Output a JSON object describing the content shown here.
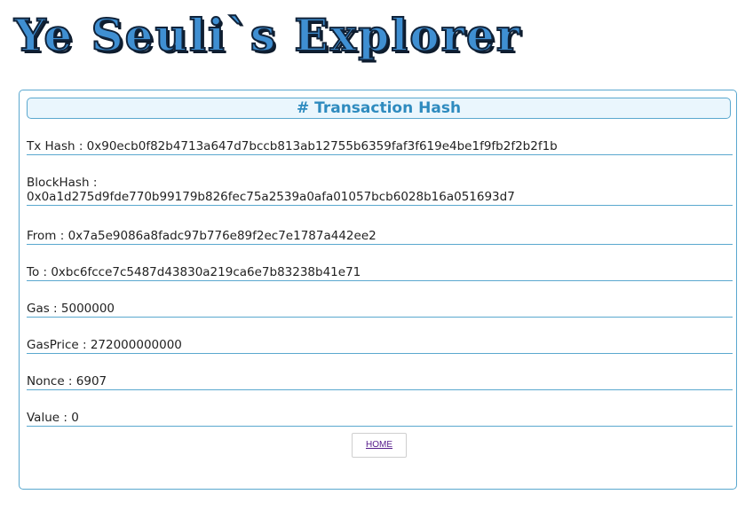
{
  "header": {
    "logo_text": "Ye Seuli`s Explorer"
  },
  "panel": {
    "title": "# Transaction Hash"
  },
  "fields": {
    "tx_hash": "Tx Hash : 0x90ecb0f82b4713a647d7bccb813ab12755b6359faf3f619e4be1f9fb2f2b2f1b",
    "block_hash_label": "BlockHash :",
    "block_hash_value": "0x0a1d275d9fde770b99179b826fec75a2539a0afa01057bcb6028b16a051693d7",
    "from": "From : 0x7a5e9086a8fadc97b776e89f2ec7e1787a442ee2",
    "to": "To : 0xbc6fcce7c5487d43830a219ca6e7b83238b41e71",
    "gas": "Gas : 5000000",
    "gas_price": "GasPrice : 272000000000",
    "nonce": "Nonce : 6907",
    "value": "Value : 0"
  },
  "buttons": {
    "home_label": "HOME"
  }
}
